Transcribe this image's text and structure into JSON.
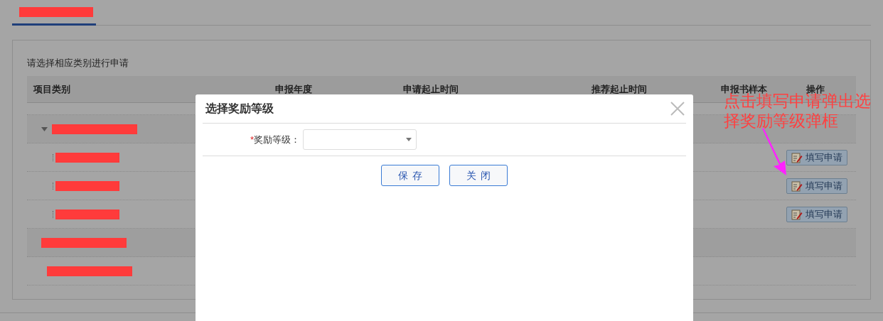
{
  "tab": {
    "selected": true
  },
  "intro": "请选择相应类别进行申请",
  "table": {
    "columns": [
      "项目类别",
      "申报年度",
      "申请起止时间",
      "推荐起止时间",
      "申报书样本",
      "操作"
    ],
    "rows": [
      {
        "kind": "group",
        "expanded": true
      },
      {
        "kind": "item",
        "action": "填写申请"
      },
      {
        "kind": "item",
        "action": "填写申请"
      },
      {
        "kind": "item",
        "action": "填写申请"
      },
      {
        "kind": "group"
      },
      {
        "kind": "plain"
      }
    ]
  },
  "modal": {
    "title": "选择奖励等级",
    "field": {
      "required_mark": "*",
      "label": "奖励等级："
    },
    "buttons": [
      "保存",
      "关闭"
    ]
  },
  "annotation": "点击填写申请弹出选择奖励等级弹框"
}
